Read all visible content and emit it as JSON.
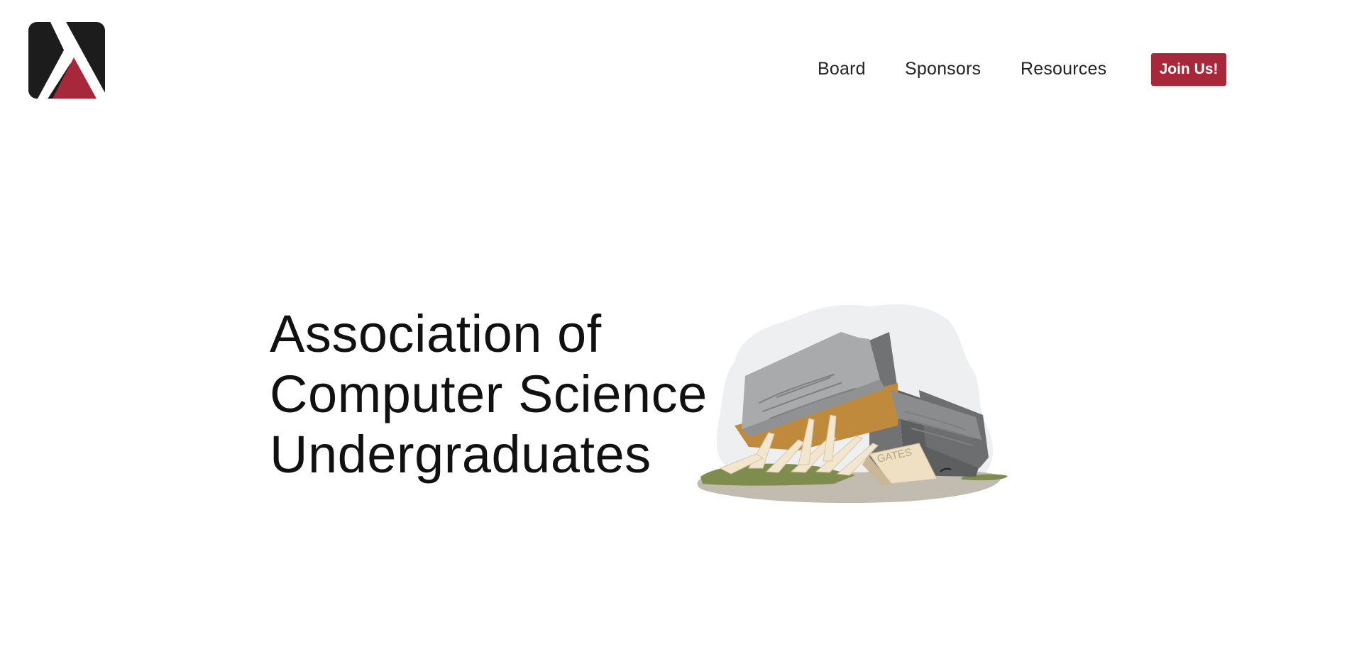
{
  "brand": {
    "logo_icon": "lambda-a-logo-icon",
    "colors": {
      "primary_red": "#a6283a",
      "logo_dark": "#1c1c1c"
    }
  },
  "nav": {
    "items": [
      {
        "label": "Board"
      },
      {
        "label": "Sponsors"
      },
      {
        "label": "Resources"
      }
    ],
    "cta_label": "Join Us!"
  },
  "hero": {
    "title_lines": [
      "Association of",
      "Computer Science",
      "Undergraduates"
    ],
    "illustration_icon": "gates-building-illustration",
    "building_sign": "GATES"
  }
}
